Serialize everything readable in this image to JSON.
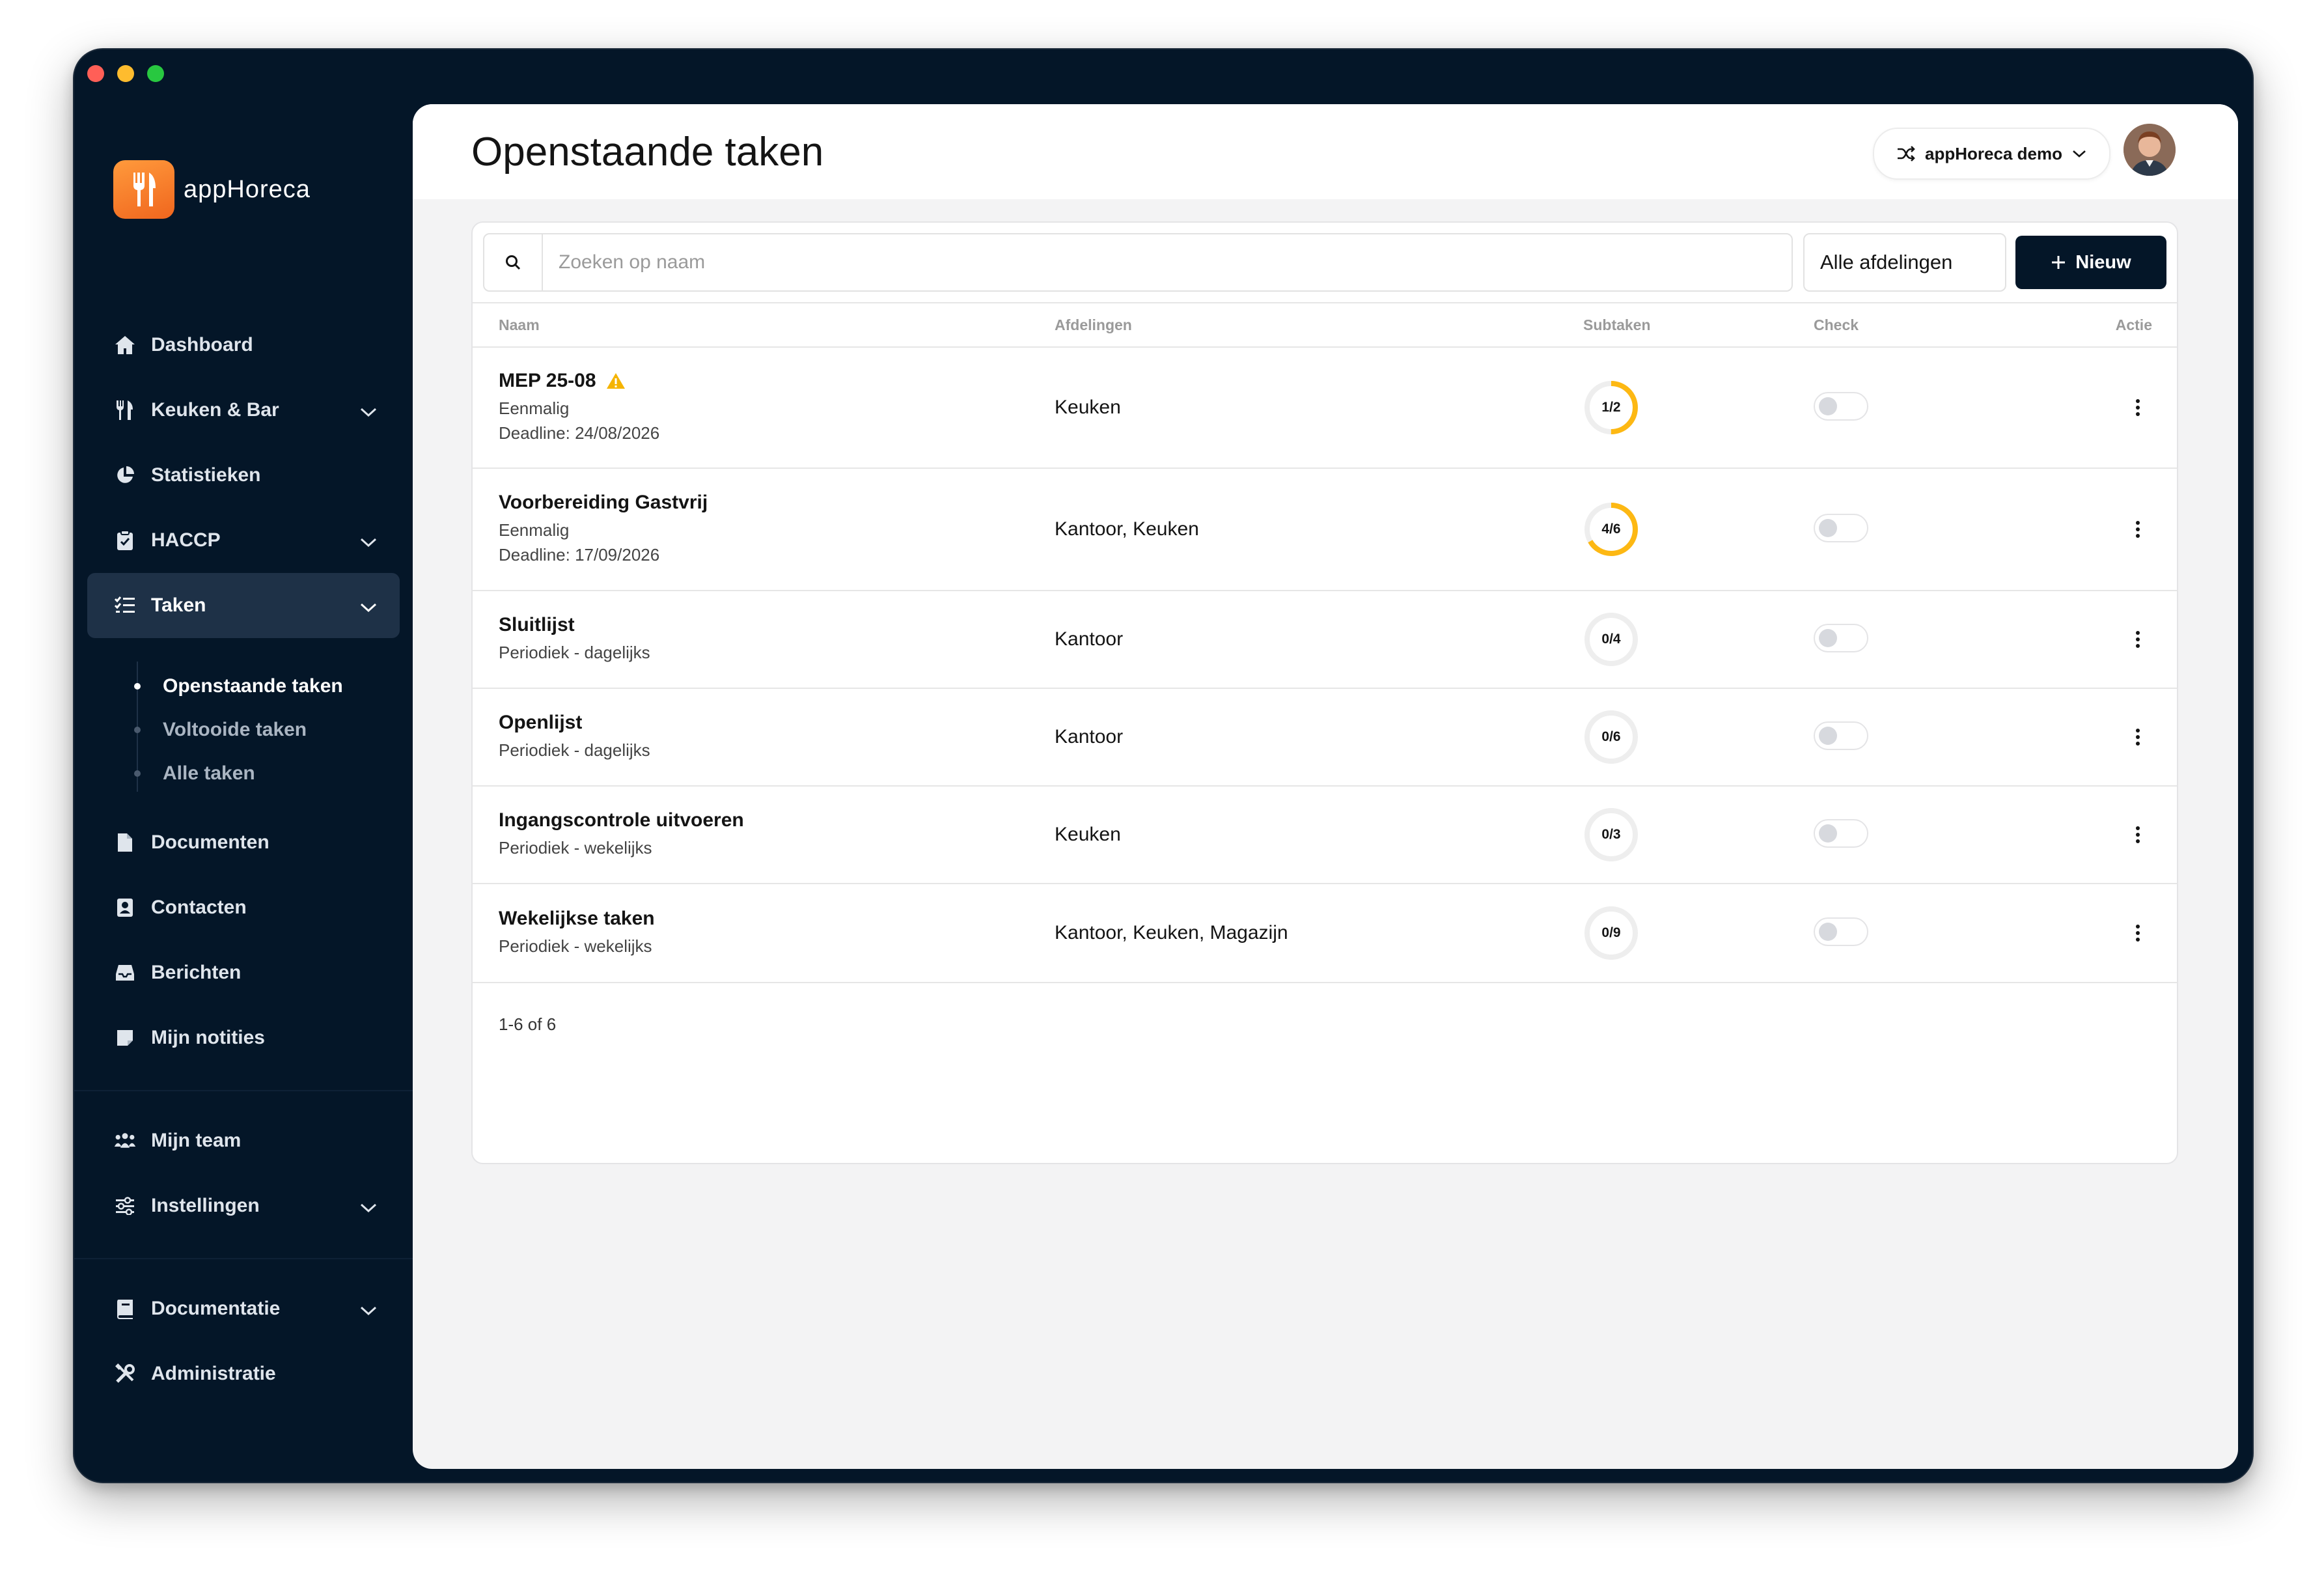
{
  "app": {
    "name": "appHoreca"
  },
  "sidebar": {
    "items": [
      {
        "label": "Dashboard",
        "icon": "home-icon"
      },
      {
        "label": "Keuken & Bar",
        "icon": "utensils-icon",
        "expandable": true
      },
      {
        "label": "Statistieken",
        "icon": "pie-chart-icon"
      },
      {
        "label": "HACCP",
        "icon": "clipboard-check-icon",
        "expandable": true
      },
      {
        "label": "Taken",
        "icon": "task-list-icon",
        "expandable": true,
        "active": true
      },
      {
        "label": "Documenten",
        "icon": "document-icon"
      },
      {
        "label": "Contacten",
        "icon": "contact-icon"
      },
      {
        "label": "Berichten",
        "icon": "inbox-icon"
      },
      {
        "label": "Mijn notities",
        "icon": "note-icon"
      },
      {
        "label": "Mijn team",
        "icon": "team-icon"
      },
      {
        "label": "Instellingen",
        "icon": "sliders-icon",
        "expandable": true
      },
      {
        "label": "Documentatie",
        "icon": "book-icon",
        "expandable": true
      },
      {
        "label": "Administratie",
        "icon": "tools-icon"
      }
    ],
    "taken_subitems": [
      {
        "label": "Openstaande taken",
        "active": true
      },
      {
        "label": "Voltooide taken",
        "active": false
      },
      {
        "label": "Alle taken",
        "active": false
      }
    ]
  },
  "header": {
    "title": "Openstaande taken",
    "organization": "appHoreca demo"
  },
  "toolbar": {
    "search_placeholder": "Zoeken op naam",
    "search_value": "",
    "department_filter": "Alle afdelingen",
    "new_button": "Nieuw"
  },
  "table": {
    "columns": [
      "Naam",
      "Afdelingen",
      "Subtaken",
      "Check",
      "Actie"
    ],
    "rows": [
      {
        "name": "MEP 25-08",
        "warning": true,
        "type": "Eenmalig",
        "deadline": "Deadline: 24/08/2026",
        "departments": "Keuken",
        "subtasks": "1/2",
        "done": 1,
        "total": 2,
        "checked": false
      },
      {
        "name": "Voorbereiding Gastvrij",
        "warning": false,
        "type": "Eenmalig",
        "deadline": "Deadline: 17/09/2026",
        "departments": "Kantoor, Keuken",
        "subtasks": "4/6",
        "done": 4,
        "total": 6,
        "checked": false
      },
      {
        "name": "Sluitlijst",
        "warning": false,
        "type": "Periodiek - dagelijks",
        "deadline": "",
        "departments": "Kantoor",
        "subtasks": "0/4",
        "done": 0,
        "total": 4,
        "checked": false
      },
      {
        "name": "Openlijst",
        "warning": false,
        "type": "Periodiek - dagelijks",
        "deadline": "",
        "departments": "Kantoor",
        "subtasks": "0/6",
        "done": 0,
        "total": 6,
        "checked": false
      },
      {
        "name": "Ingangscontrole uitvoeren",
        "warning": false,
        "type": "Periodiek - wekelijks",
        "deadline": "",
        "departments": "Keuken",
        "subtasks": "0/3",
        "done": 0,
        "total": 3,
        "checked": false
      },
      {
        "name": "Wekelijkse taken",
        "warning": false,
        "type": "Periodiek - wekelijks",
        "deadline": "",
        "departments": "Kantoor, Keuken, Magazijn",
        "subtasks": "0/9",
        "done": 0,
        "total": 9,
        "checked": false
      }
    ],
    "pagination": "1-6 of 6"
  },
  "colors": {
    "sidebar_bg": "#041628",
    "active_item_bg": "#1e3147",
    "accent_orange": "#f0661e",
    "progress_yellow": "#fdb813",
    "warning_yellow": "#f5b400"
  }
}
